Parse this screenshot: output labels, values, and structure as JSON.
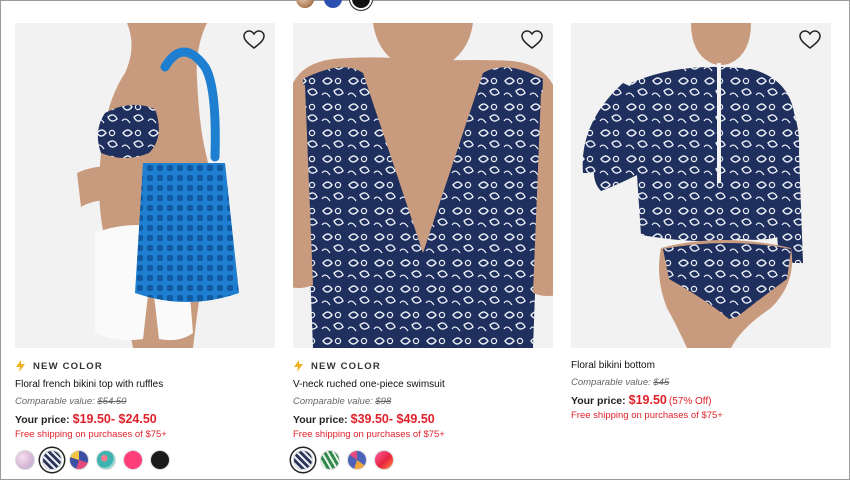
{
  "top_swatches": [
    {
      "name": "tortoise"
    },
    {
      "name": "blue"
    },
    {
      "name": "black"
    }
  ],
  "products": [
    {
      "badge": "NEW COLOR",
      "name": "Floral french bikini top with ruffles",
      "comparable_label": "Comparable value:",
      "comparable_value": "$54.50",
      "price_label": "Your price:",
      "price": "$19.50- $24.50",
      "discount": "",
      "shipping": "Free shipping on purchases of $75+",
      "icons": {
        "wishlist": "heart-outline-icon",
        "badge": "lightning-bolt-icon"
      },
      "swatches": [
        {
          "name": "pink floral",
          "color": "#d9b8d6"
        },
        {
          "name": "navy floral",
          "color": "#2a3558",
          "selected": true
        },
        {
          "name": "blue multi",
          "color": "#3d4fa5"
        },
        {
          "name": "teal floral",
          "color": "#3fb3b0"
        },
        {
          "name": "hot pink",
          "color": "#ff3e7a"
        },
        {
          "name": "black",
          "color": "#1a1a1a"
        }
      ]
    },
    {
      "badge": "NEW COLOR",
      "name": "V-neck ruched one-piece swimsuit",
      "comparable_label": "Comparable value:",
      "comparable_value": "$98",
      "price_label": "Your price:",
      "price": "$39.50- $49.50",
      "discount": "",
      "shipping": "Free shipping on purchases of $75+",
      "icons": {
        "wishlist": "heart-outline-icon",
        "badge": "lightning-bolt-icon"
      },
      "swatches": [
        {
          "name": "navy floral",
          "color": "#2a3558",
          "selected": true
        },
        {
          "name": "green leaf",
          "color": "#3a9e5a"
        },
        {
          "name": "blue multi",
          "color": "#4a62b8"
        },
        {
          "name": "red pink",
          "color": "#e8233f"
        }
      ]
    },
    {
      "badge": "",
      "name": "Floral bikini bottom",
      "comparable_label": "Comparable value:",
      "comparable_value": "$45",
      "price_label": "Your price:",
      "price": "$19.50",
      "discount": "(57% Off)",
      "shipping": "Free shipping on purchases of $75+",
      "icons": {
        "wishlist": "heart-outline-icon"
      },
      "swatches": []
    }
  ],
  "colors": {
    "sale_red": "#e0212b",
    "navy_print": "#1f2f5e",
    "blue_bag": "#1e7fd0"
  }
}
